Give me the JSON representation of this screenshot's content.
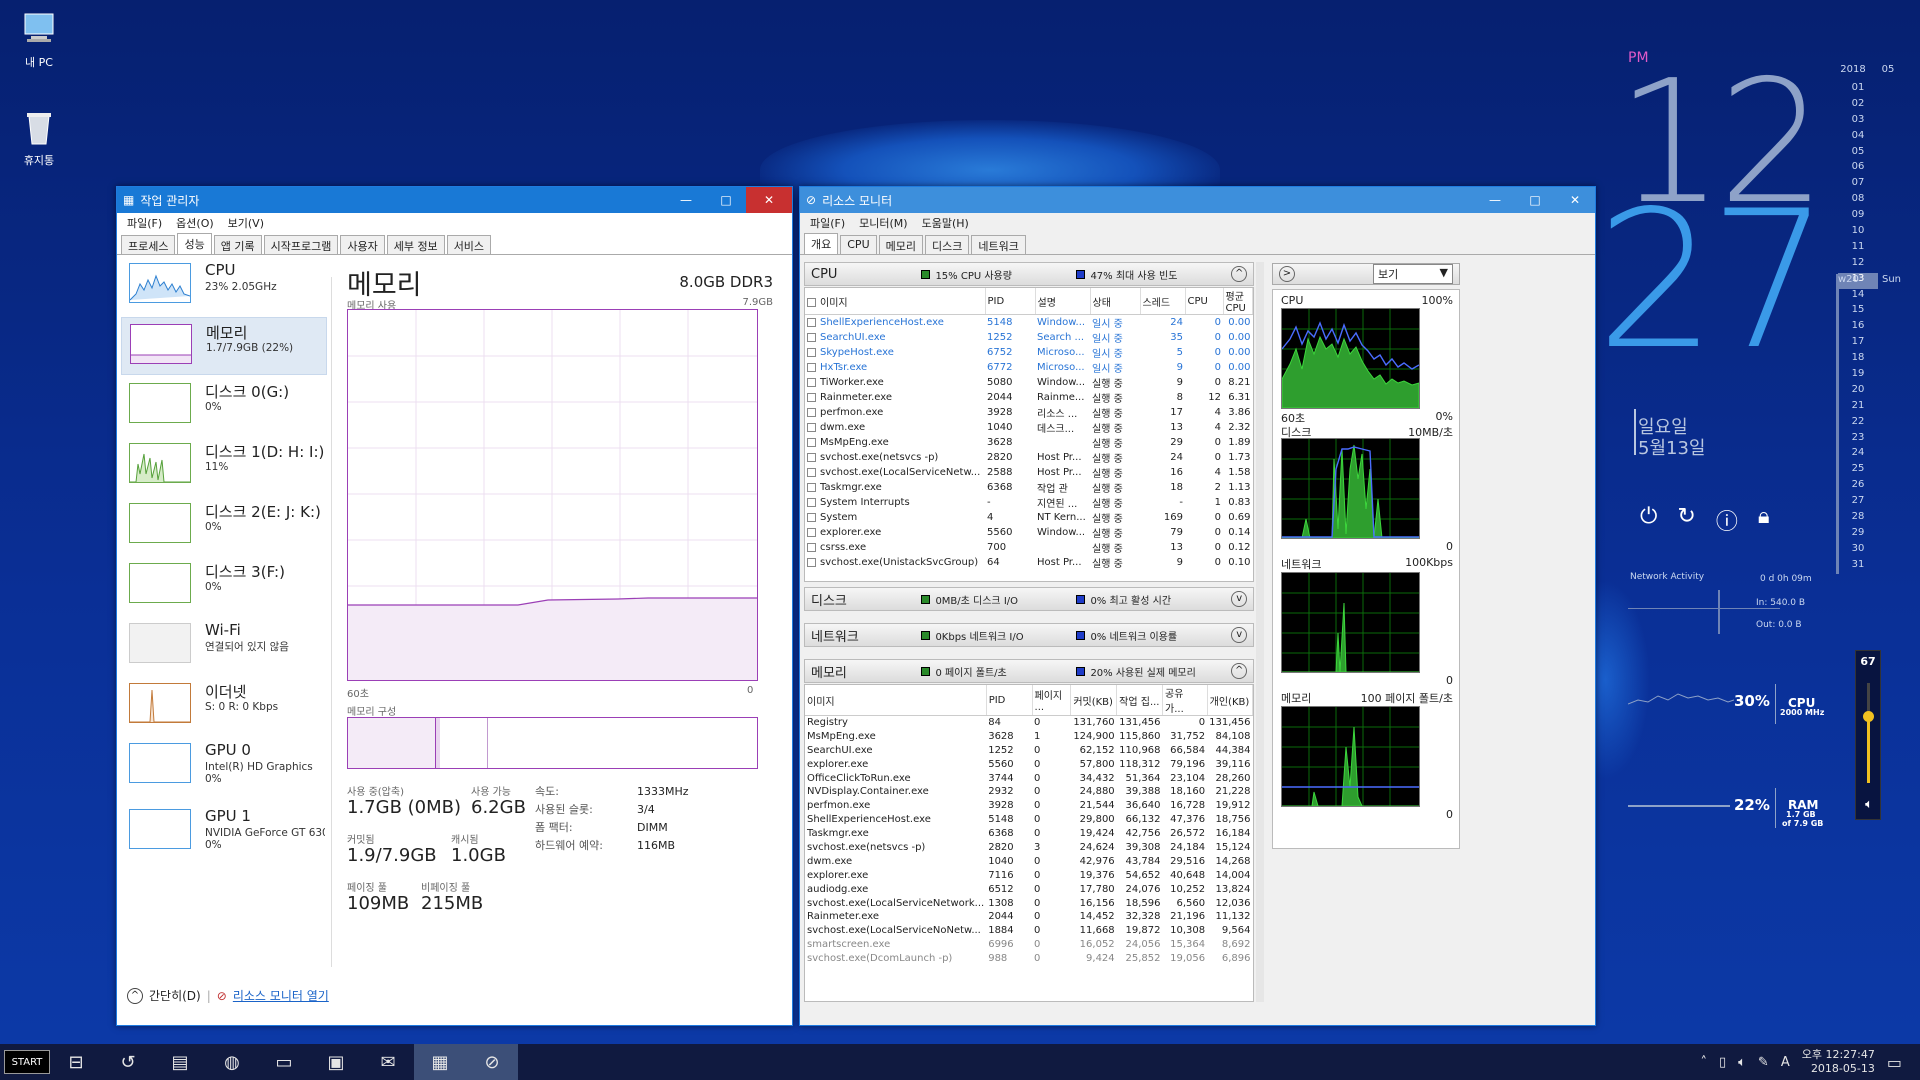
{
  "desktop": {
    "icons": [
      {
        "label": "내 PC"
      },
      {
        "label": "휴지통"
      }
    ]
  },
  "taskmgr": {
    "title": "작업 관리자",
    "menu": [
      "파일(F)",
      "옵션(O)",
      "보기(V)"
    ],
    "tabs": [
      "프로세스",
      "성능",
      "앱 기록",
      "시작프로그램",
      "사용자",
      "세부 정보",
      "서비스"
    ],
    "side": [
      {
        "name": "CPU",
        "sub": "23% 2.05GHz"
      },
      {
        "name": "메모리",
        "sub": "1.7/7.9GB (22%)"
      },
      {
        "name": "디스크 0(G:)",
        "sub": "0%"
      },
      {
        "name": "디스크 1(D: H: I:)",
        "sub": "11%"
      },
      {
        "name": "디스크 2(E: J: K:)",
        "sub": "0%"
      },
      {
        "name": "디스크 3(F:)",
        "sub": "0%"
      },
      {
        "name": "Wi-Fi",
        "sub": "연결되어 있지 않음"
      },
      {
        "name": "이더넷",
        "sub": "S: 0 R: 0 Kbps"
      },
      {
        "name": "GPU 0",
        "sub": "Intel(R) HD Graphics",
        "sub2": "0%"
      },
      {
        "name": "GPU 1",
        "sub": "NVIDIA GeForce GT 630",
        "sub2": "0%"
      }
    ],
    "main": {
      "title": "메모리",
      "spec": "8.0GB DDR3",
      "usage_label": "메모리 사용",
      "usage_max": "7.9GB",
      "axis_left": "60초",
      "axis_right": "0",
      "comp_label": "메모리 구성",
      "stats": {
        "inuse_label": "사용 중(압축)",
        "inuse_val": "1.7GB (0MB)",
        "avail_label": "사용 가능",
        "avail_val": "6.2GB",
        "commit_label": "커밋됨",
        "commit_val": "1.9/7.9GB",
        "cache_label": "캐시됨",
        "cache_val": "1.0GB",
        "paged_label": "페이징 풀",
        "paged_val": "109MB",
        "nonpaged_label": "비페이징 풀",
        "nonpaged_val": "215MB",
        "speed_label": "속도:",
        "speed_val": "1333MHz",
        "slots_label": "사용된 슬롯:",
        "slots_val": "3/4",
        "form_label": "폼 팩터:",
        "form_val": "DIMM",
        "reserved_label": "하드웨어 예약:",
        "reserved_val": "116MB"
      }
    },
    "footer": {
      "brief": "간단히(D)",
      "link": "리소스 모니터 열기"
    }
  },
  "resmon": {
    "title": "리소스 모니터",
    "menu": [
      "파일(F)",
      "모니터(M)",
      "도움말(H)"
    ],
    "tabs": [
      "개요",
      "CPU",
      "메모리",
      "디스크",
      "네트워크"
    ],
    "cpu_section": {
      "title": "CPU",
      "leg1": "15% CPU 사용량",
      "leg2": "47% 최대 사용 빈도"
    },
    "cpu_headers": [
      "이미지",
      "PID",
      "설명",
      "상태",
      "스레드",
      "CPU",
      "평균 CPU"
    ],
    "cpu_rows": [
      [
        "ShellExperienceHost.exe",
        "5148",
        "Window...",
        "일시 중",
        "24",
        "0",
        "0.00",
        "blue"
      ],
      [
        "SearchUI.exe",
        "1252",
        "Search ...",
        "일시 중",
        "35",
        "0",
        "0.00",
        "blue"
      ],
      [
        "SkypeHost.exe",
        "6752",
        "Microso...",
        "일시 중",
        "5",
        "0",
        "0.00",
        "blue"
      ],
      [
        "HxTsr.exe",
        "6772",
        "Microso...",
        "일시 중",
        "9",
        "0",
        "0.00",
        "blue"
      ],
      [
        "TiWorker.exe",
        "5080",
        "Window...",
        "실행 중",
        "9",
        "0",
        "8.21",
        ""
      ],
      [
        "Rainmeter.exe",
        "2044",
        "Rainme...",
        "실행 중",
        "8",
        "12",
        "6.31",
        ""
      ],
      [
        "perfmon.exe",
        "3928",
        "리소스 ...",
        "실행 중",
        "17",
        "4",
        "3.86",
        ""
      ],
      [
        "dwm.exe",
        "1040",
        "데스크...",
        "실행 중",
        "13",
        "4",
        "2.32",
        ""
      ],
      [
        "MsMpEng.exe",
        "3628",
        "",
        "실행 중",
        "29",
        "0",
        "1.89",
        ""
      ],
      [
        "svchost.exe(netsvcs -p)",
        "2820",
        "Host Pr...",
        "실행 중",
        "24",
        "0",
        "1.73",
        ""
      ],
      [
        "svchost.exe(LocalServiceNetw...",
        "2588",
        "Host Pr...",
        "실행 중",
        "16",
        "4",
        "1.58",
        ""
      ],
      [
        "Taskmgr.exe",
        "6368",
        "작업 관",
        "실행 중",
        "18",
        "2",
        "1.13",
        ""
      ],
      [
        "System Interrupts",
        "-",
        "지연된 ...",
        "실행 중",
        "-",
        "1",
        "0.83",
        ""
      ],
      [
        "System",
        "4",
        "NT Kern...",
        "실행 중",
        "169",
        "0",
        "0.69",
        ""
      ],
      [
        "explorer.exe",
        "5560",
        "Window...",
        "실행 중",
        "79",
        "0",
        "0.14",
        ""
      ],
      [
        "csrss.exe",
        "700",
        "",
        "실행 중",
        "13",
        "0",
        "0.12",
        ""
      ],
      [
        "svchost.exe(UnistackSvcGroup)",
        "64",
        "Host Pr...",
        "실행 중",
        "9",
        "0",
        "0.10",
        ""
      ]
    ],
    "disk_section": {
      "title": "디스크",
      "leg1": "0MB/초 디스크 I/O",
      "leg2": "0% 최고 활성 시간"
    },
    "net_section": {
      "title": "네트워크",
      "leg1": "0Kbps 네트워크 I/O",
      "leg2": "0% 네트워크 이용률"
    },
    "mem_section": {
      "title": "메모리",
      "leg1": "0 페이지 폴트/초",
      "leg2": "20% 사용된 실제 메모리"
    },
    "mem_headers": [
      "이미지",
      "PID",
      "페이지 ...",
      "커밋(KB)",
      "작업 집...",
      "공유 가...",
      "개인(KB)"
    ],
    "mem_rows": [
      [
        "Registry",
        "84",
        "0",
        "131,760",
        "131,456",
        "0",
        "131,456"
      ],
      [
        "MsMpEng.exe",
        "3628",
        "1",
        "124,900",
        "115,860",
        "31,752",
        "84,108"
      ],
      [
        "SearchUI.exe",
        "1252",
        "0",
        "62,152",
        "110,968",
        "66,584",
        "44,384"
      ],
      [
        "explorer.exe",
        "5560",
        "0",
        "57,800",
        "118,312",
        "79,196",
        "39,116"
      ],
      [
        "OfficeClickToRun.exe",
        "3744",
        "0",
        "34,432",
        "51,364",
        "23,104",
        "28,260"
      ],
      [
        "NVDisplay.Container.exe",
        "2932",
        "0",
        "24,880",
        "39,388",
        "18,160",
        "21,228"
      ],
      [
        "perfmon.exe",
        "3928",
        "0",
        "21,544",
        "36,640",
        "16,728",
        "19,912"
      ],
      [
        "ShellExperienceHost.exe",
        "5148",
        "0",
        "29,800",
        "66,132",
        "47,376",
        "18,756"
      ],
      [
        "Taskmgr.exe",
        "6368",
        "0",
        "19,424",
        "42,756",
        "26,572",
        "16,184"
      ],
      [
        "svchost.exe(netsvcs -p)",
        "2820",
        "3",
        "24,624",
        "39,308",
        "24,184",
        "15,124"
      ],
      [
        "dwm.exe",
        "1040",
        "0",
        "42,976",
        "43,784",
        "29,516",
        "14,268"
      ],
      [
        "explorer.exe",
        "7116",
        "0",
        "19,376",
        "54,652",
        "40,648",
        "14,004"
      ],
      [
        "audiodg.exe",
        "6512",
        "0",
        "17,780",
        "24,076",
        "10,252",
        "13,824"
      ],
      [
        "svchost.exe(LocalServiceNetwork...",
        "1308",
        "0",
        "16,156",
        "18,596",
        "6,560",
        "12,036"
      ],
      [
        "Rainmeter.exe",
        "2044",
        "0",
        "14,452",
        "32,328",
        "21,196",
        "11,132"
      ],
      [
        "svchost.exe(LocalServiceNoNetw...",
        "1884",
        "0",
        "11,668",
        "19,872",
        "10,308",
        "9,564"
      ],
      [
        "smartscreen.exe",
        "6996",
        "0",
        "16,052",
        "24,056",
        "15,364",
        "8,692"
      ],
      [
        "svchost.exe(DcomLaunch -p)",
        "988",
        "0",
        "9,424",
        "25,852",
        "19,056",
        "6,896"
      ]
    ],
    "right": {
      "view_label": "보기",
      "g_cpu": {
        "name": "CPU",
        "max": "100%",
        "left": "60초",
        "right": "0%"
      },
      "g_disk": {
        "name": "디스크",
        "max": "10MB/초",
        "right": "0"
      },
      "g_net": {
        "name": "네트워크",
        "max": "100Kbps",
        "right": "0"
      },
      "g_mem": {
        "name": "메모리",
        "max": "100 페이지 폴트/초",
        "right": "0"
      }
    }
  },
  "widget": {
    "ampm": "PM",
    "hour": "12",
    "minute": "27",
    "dayname": "일요일",
    "date": "5월13일",
    "cal_year": "2018",
    "cal_month": "05",
    "cal_days": [
      "01",
      "02",
      "03",
      "04",
      "05",
      "06",
      "07",
      "08",
      "09",
      "10",
      "11",
      "12",
      "13",
      "14",
      "15",
      "16",
      "17",
      "18",
      "19",
      "20",
      "21",
      "22",
      "23",
      "24",
      "25",
      "26",
      "27",
      "28",
      "29",
      "30",
      "31"
    ],
    "week": "w20",
    "today": "13",
    "today_name": "Sun",
    "net_title": "Network Activity",
    "uptime": "0 d 0h 09m",
    "net_in": "In: 540.0 B",
    "net_out": "Out: 0.0 B",
    "cpu_pct": "30%",
    "cpu_label": "CPU",
    "cpu_freq": "2000 MHz",
    "ram_pct": "22%",
    "ram_label": "RAM",
    "ram_detail1": "1.7 GB",
    "ram_detail2": "of 7.9 GB",
    "volume": "67"
  },
  "taskbar": {
    "start": "START",
    "time": "오후 12:27:47",
    "date": "2018-05-13",
    "ime": "A"
  }
}
